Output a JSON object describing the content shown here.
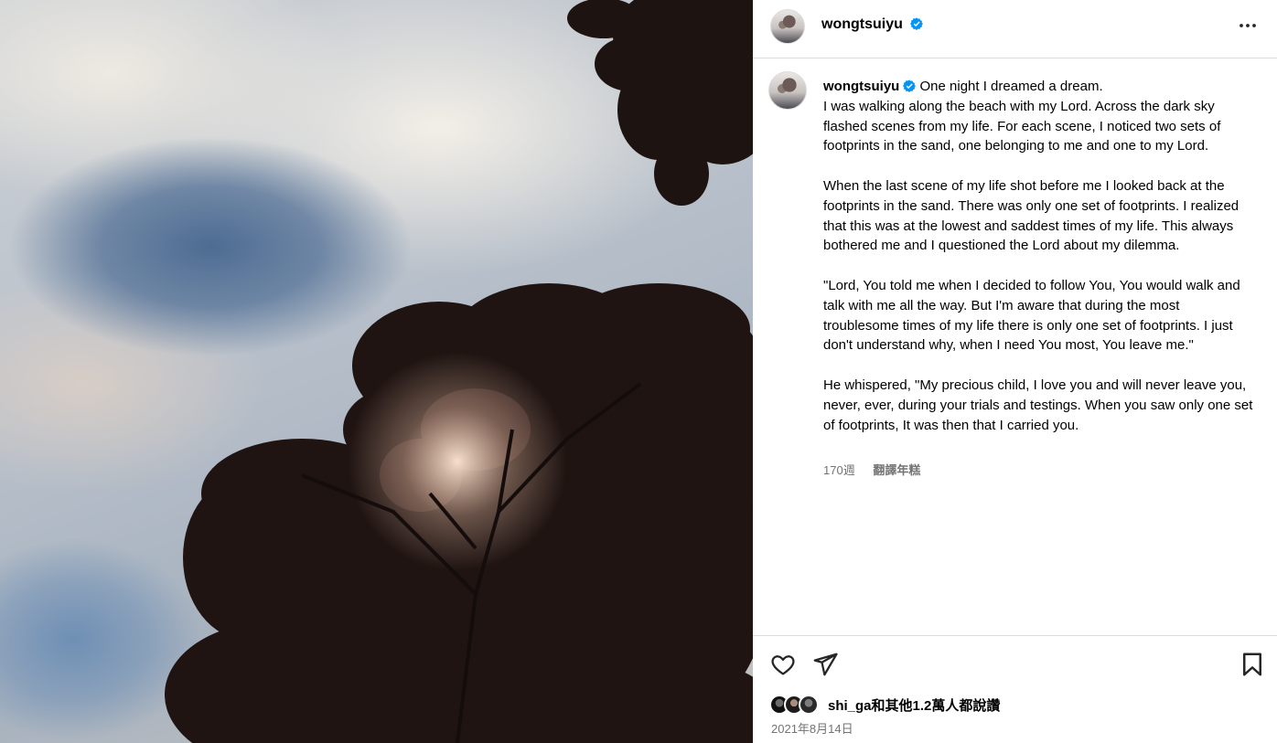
{
  "post": {
    "username": "wongtsuiyu",
    "verified": true,
    "caption": {
      "first_line": "One night I dreamed a dream.",
      "paragraphs": [
        "I was walking along the beach with my Lord. Across the dark sky flashed scenes from my life. For each scene, I noticed two sets of footprints in the sand, one belonging to me and one to my Lord.",
        "When the last scene of my life shot before me I looked back at the footprints in the sand. There was only one set of footprints. I realized that this was at the lowest and saddest times of my life. This always bothered me and I questioned the Lord about my dilemma.",
        "\"Lord, You told me when I decided to follow You, You would walk and talk with me all the way. But I'm aware that during the most troublesome times of my life there is only one set of footprints. I just don't understand why, when I need You most, You leave me.\"",
        "He whispered, \"My precious child, I love you and will never leave you, never, ever, during your trials and testings. When you saw only one set of footprints, It was then that I carried you."
      ]
    },
    "age": "170週",
    "translate_label": "翻譯年糕",
    "likes_text": "shi_ga和其他1.2萬人都說讚",
    "date": "2021年8月14日"
  },
  "icons": {
    "more": "more-horizontal-icon",
    "like": "heart-icon",
    "share": "send-icon",
    "save": "bookmark-icon",
    "verified": "verified-badge-icon"
  },
  "colors": {
    "verified_blue": "#0095f6",
    "divider": "#dbdbdb",
    "secondary_text": "#737373"
  }
}
